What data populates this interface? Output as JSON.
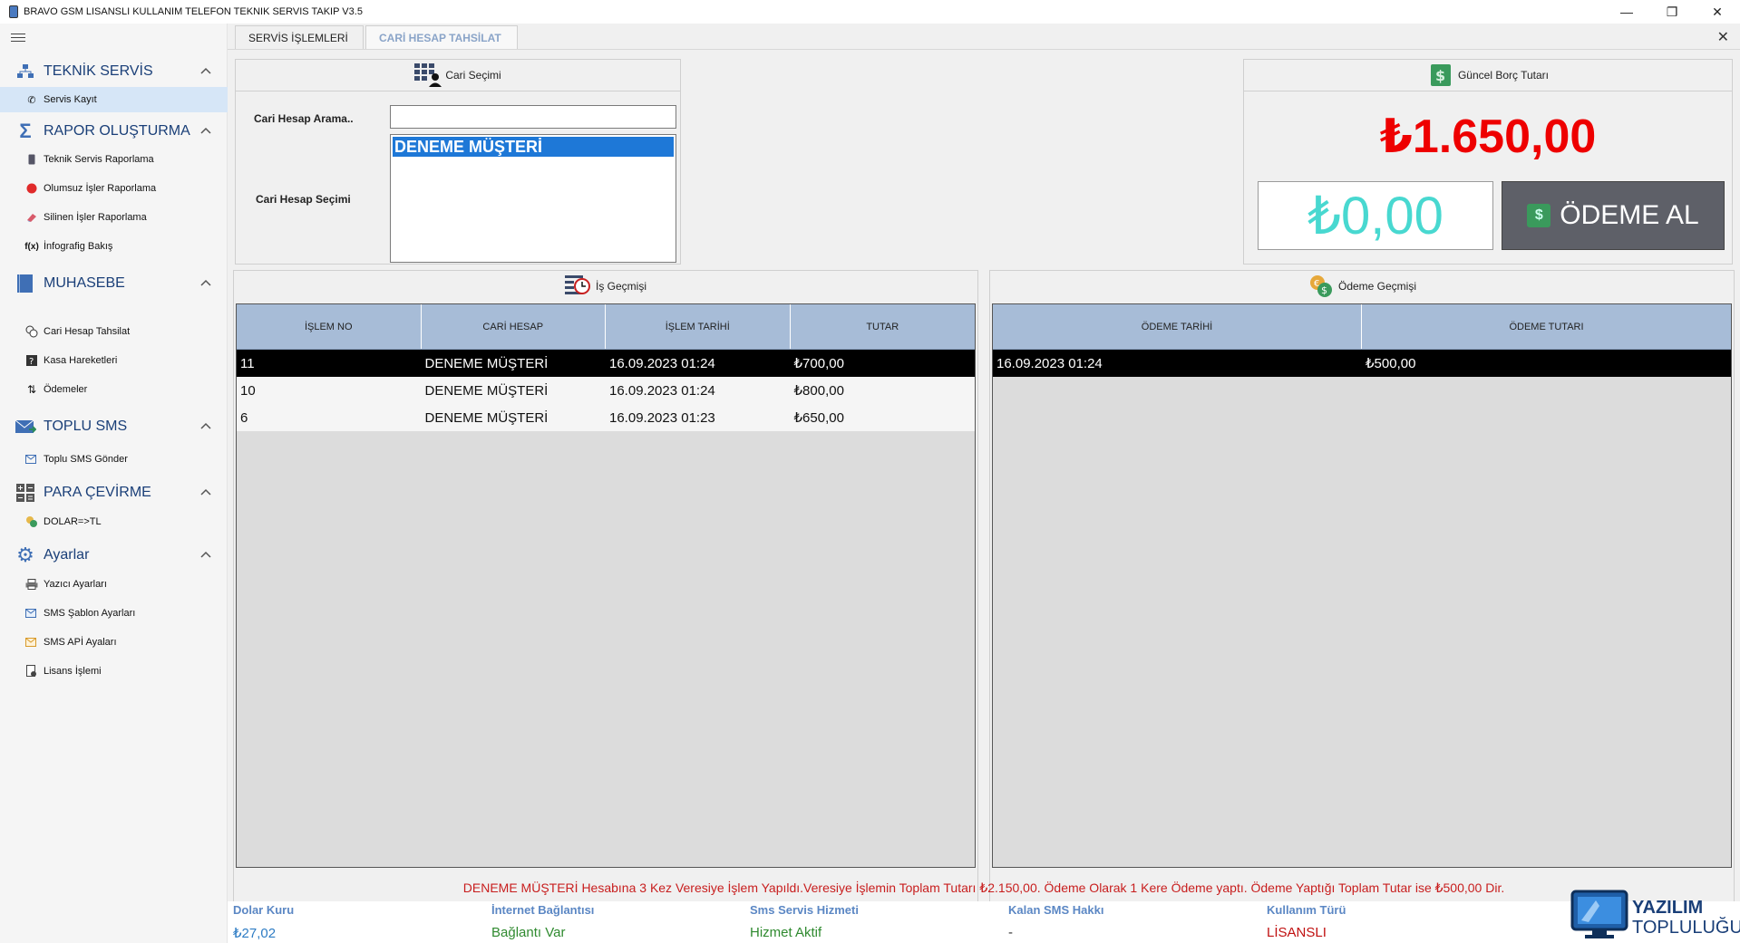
{
  "window": {
    "title": "BRAVO GSM LISANSLI KULLANIM TELEFON TEKNIK SERVIS TAKIP V3.5"
  },
  "sidebar": {
    "sections": [
      {
        "label": "TEKNİK SERVİS",
        "items": [
          {
            "label": "Servis Kayıt"
          }
        ]
      },
      {
        "label": "RAPOR OLUŞTURMA",
        "items": [
          {
            "label": "Teknik Servis Raporlama"
          },
          {
            "label": "Olumsuz İşler Raporlama"
          },
          {
            "label": "Silinen İşler Raporlama"
          },
          {
            "label": "İnfografig Bakış"
          }
        ]
      },
      {
        "label": "MUHASEBE",
        "items": [
          {
            "label": "Cari Hesap Tahsilat"
          },
          {
            "label": "Kasa Hareketleri"
          },
          {
            "label": "Ödemeler"
          }
        ]
      },
      {
        "label": "TOPLU SMS",
        "items": [
          {
            "label": "Toplu SMS Gönder"
          }
        ]
      },
      {
        "label": "PARA ÇEVİRME",
        "items": [
          {
            "label": "DOLAR=>TL"
          }
        ]
      },
      {
        "label": "Ayarlar",
        "items": [
          {
            "label": "Yazıcı Ayarları"
          },
          {
            "label": "SMS Şablon Ayarları"
          },
          {
            "label": "SMS APİ Ayaları"
          },
          {
            "label": "Lisans İşlemi"
          }
        ]
      }
    ]
  },
  "tabs": [
    {
      "label": "SERVİS İŞLEMLERİ",
      "active": false
    },
    {
      "label": "CARİ HESAP TAHSİLAT",
      "active": true
    }
  ],
  "cari": {
    "header": "Cari Seçimi",
    "search_label": "Cari Hesap Arama..",
    "search_value": "",
    "select_label": "Cari Hesap Seçimi",
    "options": [
      "DENEME MÜŞTERİ"
    ]
  },
  "borc": {
    "header": "Güncel Borç Tutarı",
    "amount": "₺1.650,00",
    "payment_input": "₺0,00",
    "pay_button": "ÖDEME AL"
  },
  "is_gecmisi": {
    "header": "İş Geçmişi",
    "columns": [
      "İŞLEM NO",
      "CARİ HESAP",
      "İŞLEM TARİHİ",
      "TUTAR"
    ],
    "rows": [
      [
        "11",
        "DENEME MÜŞTERİ",
        "16.09.2023 01:24",
        "₺700,00"
      ],
      [
        "10",
        "DENEME MÜŞTERİ",
        "16.09.2023 01:24",
        "₺800,00"
      ],
      [
        "6",
        "DENEME MÜŞTERİ",
        "16.09.2023 01:23",
        "₺650,00"
      ]
    ]
  },
  "odeme_gecmisi": {
    "header": "Ödeme Geçmişi",
    "columns": [
      "ÖDEME TARİHİ",
      "ÖDEME TUTARI"
    ],
    "rows": [
      [
        "16.09.2023 01:24",
        "₺500,00"
      ]
    ]
  },
  "summary": "DENEME MÜŞTERİ Hesabına 3 Kez Veresiye İşlem Yapıldı.Veresiye İşlemin Toplam Tutarı ₺2.150,00. Ödeme Olarak 1 Kere Ödeme yaptı. Ödeme Yaptığı Toplam Tutar ise ₺500,00 Dir.",
  "status": {
    "dolar_label": "Dolar Kuru",
    "dolar_value": "₺27,02",
    "internet_label": "İnternet Bağlantısı",
    "internet_value": "Bağlantı Var",
    "sms_label": "Sms Servis Hizmeti",
    "sms_value": "Hizmet Aktif",
    "kalan_label": "Kalan SMS Hakkı",
    "kalan_value": "-",
    "lisans_label": "Kullanım Türü",
    "lisans_value": "LİSANSLI"
  },
  "watermark": {
    "line1": "YAZILIM",
    "line2": "TOPLULUĞU"
  },
  "colors": {
    "debt_red": "#ee0000",
    "payment_cyan": "#48d8d0",
    "grid_header": "#a7bcd7",
    "accent_blue": "#1a3f78"
  }
}
